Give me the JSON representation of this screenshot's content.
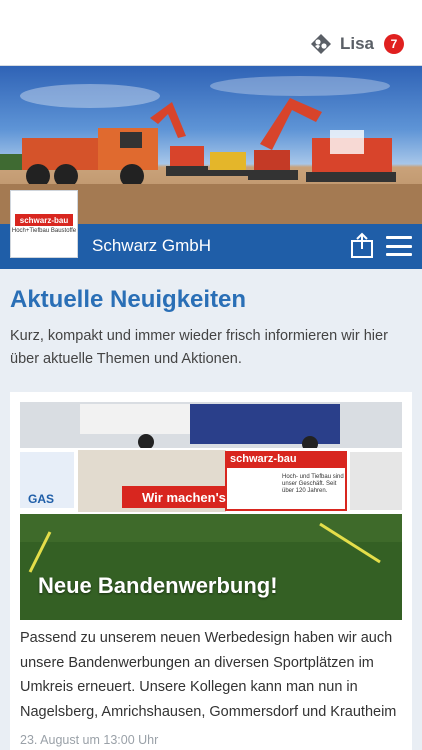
{
  "header": {
    "user_name": "Lisa",
    "notification_count": "7",
    "user_icon": "user-group-icon"
  },
  "company": {
    "name": "Schwarz GmbH",
    "logo_text": "schwarz-bau",
    "logo_subtext": "Hoch+Tiefbau Baustoffe",
    "share_icon": "share-icon",
    "menu_icon": "hamburger-menu-icon"
  },
  "section": {
    "title": "Aktuelle Neuigkeiten",
    "intro": "Kurz, kompakt und immer wieder frisch informieren wir hier über aktuelle Themen und Aktionen."
  },
  "news": [
    {
      "title": "Neue Bandenwerbung!",
      "text": "Passend zu unserem neuen Werbedesign haben wir auch unsere Bandenwerbungen an diversen Sportplätzen im Umkreis erneuert. Unsere Kollegen kann man nun in Nagelsberg, Amrichshausen, Gommersdorf und Krautheim",
      "date": "23. August um 13:00 Uhr",
      "banner_text": "Wir machen's!",
      "banner_brand": "schwarz-bau",
      "banner_tagline": "Hoch- und Tiefbau sind unser Geschäft. Seit über 120 Jahren.",
      "side_text": "GAS"
    }
  ],
  "colors": {
    "brand_blue": "#1f5ea8",
    "title_blue": "#2a6fb6",
    "badge_red": "#e0201f",
    "page_bg": "#e9eef4"
  }
}
